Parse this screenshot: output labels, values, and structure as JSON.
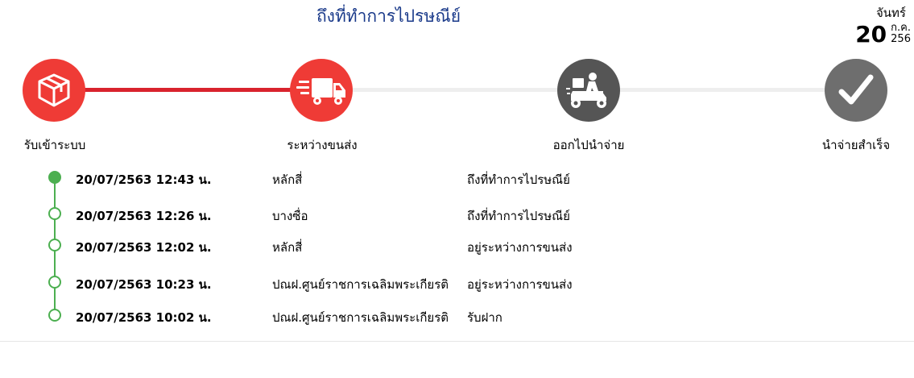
{
  "header": {
    "status_title": "ถึงที่ทำการไปรษณีย์",
    "date_day_name": "จันทร์",
    "date_day_number": "20",
    "date_month": "ก.ค.",
    "date_year": "256"
  },
  "steps": [
    {
      "label": "รับเข้าระบบ",
      "icon": "package-icon",
      "state": "done",
      "color": "#ef3b36"
    },
    {
      "label": "ระหว่างขนส่ง",
      "icon": "delivery-truck-icon",
      "state": "current",
      "color": "#ef3b36"
    },
    {
      "label": "ออกไปนำจ่าย",
      "icon": "delivery-scooter-icon",
      "state": "pending",
      "color": "#555555"
    },
    {
      "label": "นำจ่ายสำเร็จ",
      "icon": "checkmark-icon",
      "state": "pending",
      "color": "#6e6e6e"
    }
  ],
  "progress_colors": {
    "done": "#d9232d",
    "pending": "#eeeeee",
    "timeline": "#4caf50"
  },
  "events": [
    {
      "time": "20/07/2563 12:43 น.",
      "location": "หลักสี่",
      "status": "ถึงที่ทำการไปรษณีย์",
      "latest": true
    },
    {
      "time": "20/07/2563 12:26 น.",
      "location": "บางซื่อ",
      "status": "ถึงที่ทำการไปรษณีย์",
      "latest": false
    },
    {
      "time": "20/07/2563 12:02 น.",
      "location": "หลักสี่",
      "status": "อยู่ระหว่างการขนส่ง",
      "latest": false
    },
    {
      "time": "20/07/2563 10:23 น.",
      "location": "ปณฝ.ศูนย์ราชการเฉลิมพระเกียรติ",
      "status": "อยู่ระหว่างการขนส่ง",
      "latest": false
    },
    {
      "time": "20/07/2563 10:02 น.",
      "location": "ปณฝ.ศูนย์ราชการเฉลิมพระเกียรติ",
      "status": "รับฝาก",
      "latest": false
    }
  ]
}
